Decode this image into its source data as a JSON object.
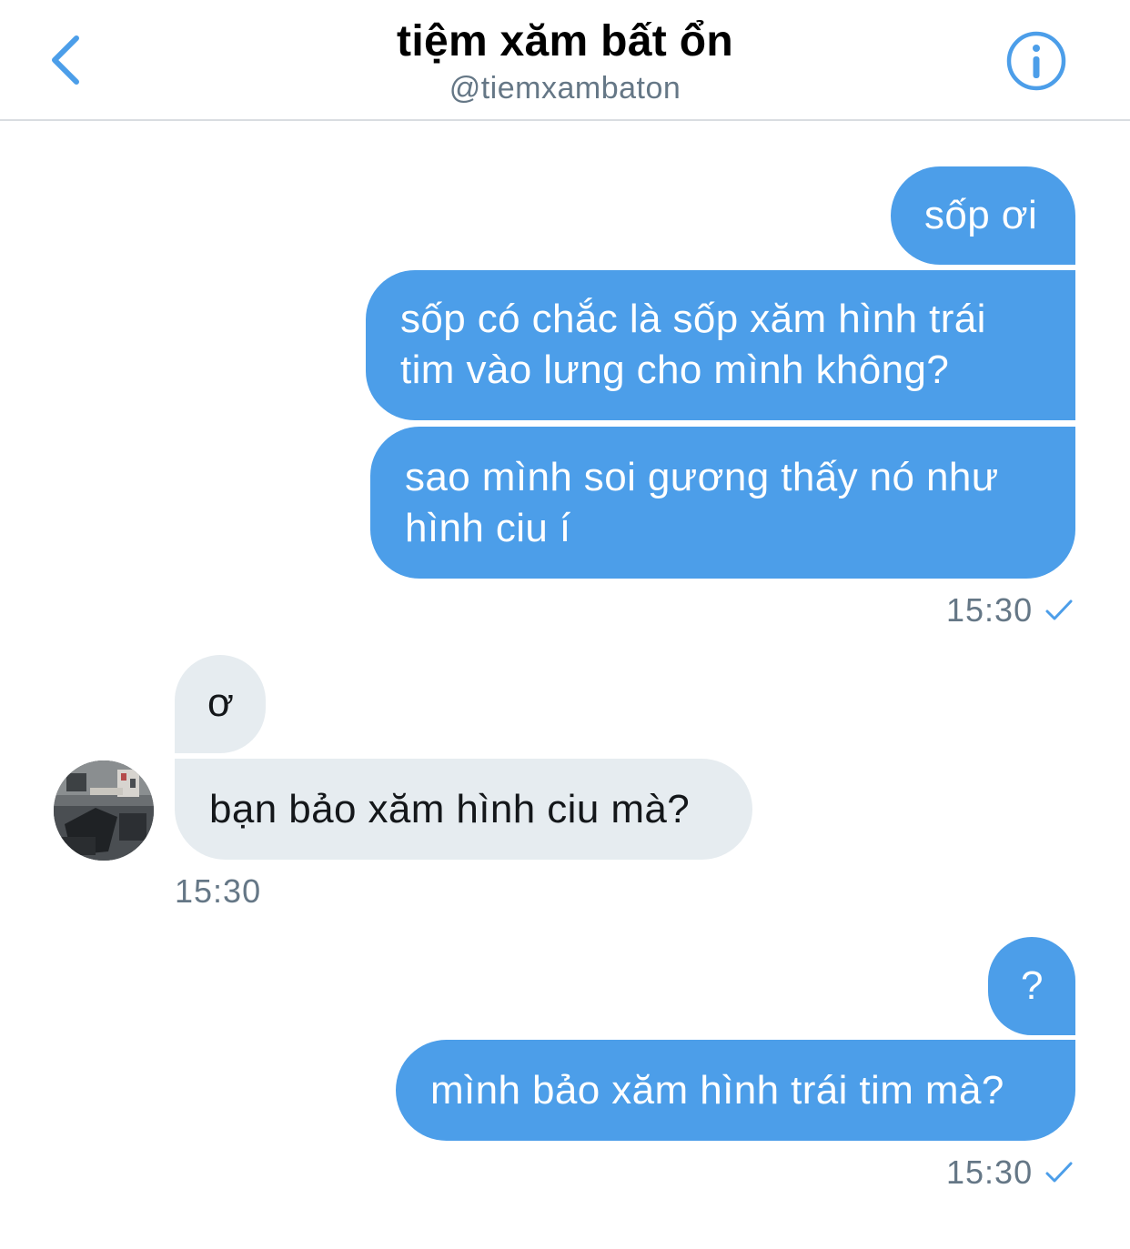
{
  "header": {
    "title": "tiệm xăm bất ổn",
    "handle": "@tiemxambaton",
    "back_icon": "chevron-left-icon",
    "info_icon": "info-circle-icon",
    "accent_color": "#4c9ee9"
  },
  "messages": [
    {
      "direction": "outgoing",
      "text": "sốp ơi"
    },
    {
      "direction": "outgoing",
      "text": "sốp có chắc là sốp xăm hình trái tim vào lưng cho mình không?"
    },
    {
      "direction": "outgoing",
      "text": "sao mình soi gương thấy nó như hình ciu í"
    },
    {
      "direction": "incoming",
      "text": "ơ"
    },
    {
      "direction": "incoming",
      "text": "bạn bảo xăm hình ciu mà?"
    },
    {
      "direction": "outgoing",
      "text": "?"
    },
    {
      "direction": "outgoing",
      "text": "mình bảo xăm hình trái tim mà?"
    }
  ],
  "timestamps": [
    {
      "text": "15:30",
      "status_icon": "check-icon"
    },
    {
      "text": "15:30"
    },
    {
      "text": "15:30",
      "status_icon": "check-icon"
    }
  ],
  "colors": {
    "outgoing_bubble": "#4c9ee9",
    "incoming_bubble": "#e6ecf0",
    "timestamp": "#657786"
  }
}
